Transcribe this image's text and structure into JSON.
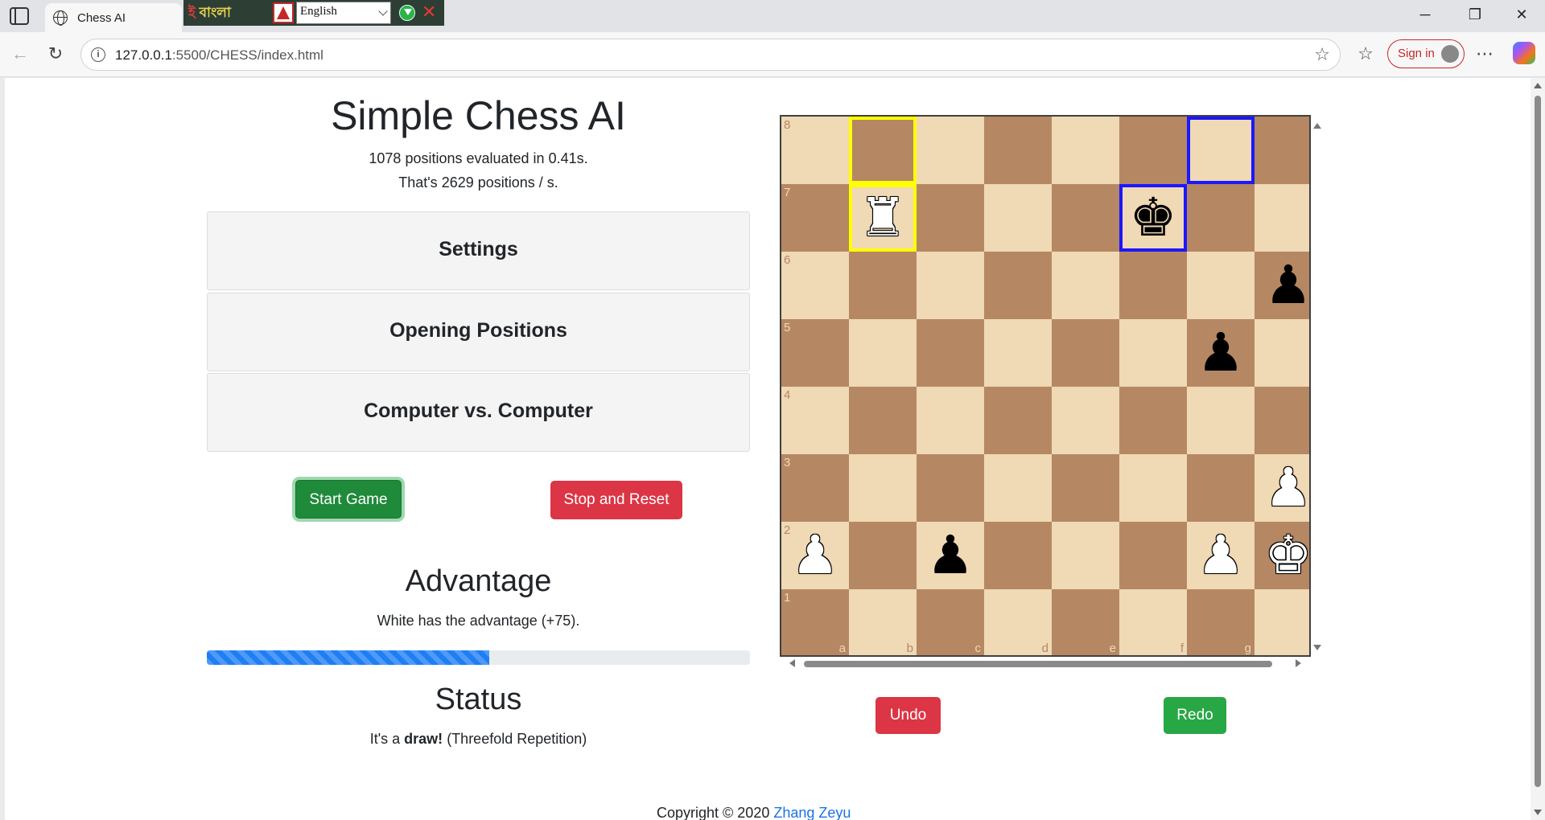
{
  "browser": {
    "tab_title": "Chess AI",
    "url_host": "127.0.0.1",
    "url_rest": ":5500/CHESS/index.html",
    "signin_label": "Sign in",
    "extension": {
      "bangla_prefix": "ই",
      "bangla_text": " বাংলা",
      "language": "English"
    }
  },
  "app": {
    "title": "Simple Chess AI",
    "stats": {
      "positions_count": "1078",
      "positions_label": " positions evaluated in ",
      "time": "0.41s.",
      "rate_prefix": "That's ",
      "rate": "2629",
      "rate_suffix": " positions / s."
    },
    "accordions": [
      "Settings",
      "Opening Positions",
      "Computer vs. Computer"
    ],
    "start_label": "Start Game",
    "stop_label": "Stop and Reset",
    "advantage": {
      "title": "Advantage",
      "text": "White has the advantage (+75).",
      "fill_fraction": 0.52
    },
    "status": {
      "title": "Status",
      "prefix": "It's a ",
      "bold": "draw!",
      "suffix": " (Threefold Repetition)"
    },
    "undo_label": "Undo",
    "redo_label": "Redo",
    "footer": {
      "text": "Copyright © 2020 ",
      "link": "Zhang Zeyu"
    }
  },
  "board": {
    "ranks": [
      "8",
      "7",
      "6",
      "5",
      "4",
      "3",
      "2",
      "1"
    ],
    "files": [
      "a",
      "b",
      "c",
      "d",
      "e",
      "f",
      "g",
      "h"
    ],
    "pieces": [
      {
        "square": "b7",
        "piece": "rook",
        "color": "white",
        "glyph": "♜"
      },
      {
        "square": "f7",
        "piece": "king",
        "color": "black",
        "glyph": "♚"
      },
      {
        "square": "h6",
        "piece": "pawn",
        "color": "black",
        "glyph": "♟"
      },
      {
        "square": "g5",
        "piece": "pawn",
        "color": "black",
        "glyph": "♟"
      },
      {
        "square": "h3",
        "piece": "pawn",
        "color": "white",
        "glyph": "♟"
      },
      {
        "square": "a2",
        "piece": "pawn",
        "color": "white",
        "glyph": "♟"
      },
      {
        "square": "c2",
        "piece": "pawn",
        "color": "black",
        "glyph": "♟"
      },
      {
        "square": "g2",
        "piece": "pawn",
        "color": "white",
        "glyph": "♟"
      },
      {
        "square": "h2",
        "piece": "king",
        "color": "white",
        "glyph": "♚"
      }
    ],
    "highlights": [
      {
        "square": "b8",
        "color": "yellow"
      },
      {
        "square": "b7",
        "color": "yellow"
      },
      {
        "square": "g8",
        "color": "blue"
      },
      {
        "square": "f7",
        "color": "blue"
      }
    ],
    "colors": {
      "light": "#f0d9b5",
      "dark": "#b58863",
      "yellow_highlight": "#ffff00",
      "blue_highlight": "#1c17ff"
    }
  }
}
